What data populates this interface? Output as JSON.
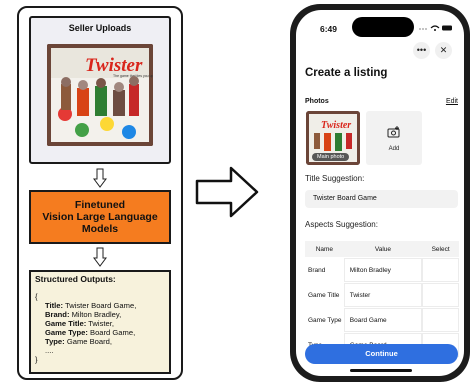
{
  "left": {
    "uploads_title": "Seller Uploads",
    "model_lines": [
      "Finetuned",
      "Vision Large Language",
      "Models"
    ],
    "outputs_title": "Structured Outputs:",
    "open_brace": "{",
    "close_brace": "}",
    "fields": [
      {
        "key": "Title:",
        "value": " Twister Board Game,"
      },
      {
        "key": "Brand:",
        "value": " Milton Bradley,"
      },
      {
        "key": "Game Title:",
        "value": " Twister,"
      },
      {
        "key": "Game Type:",
        "value": " Board Game,"
      },
      {
        "key": "Type:",
        "value": " Game Board,"
      }
    ],
    "ellipsis": "....",
    "box_text": "Twister"
  },
  "phone": {
    "time": "6:49",
    "title": "Create a listing",
    "photos_label": "Photos",
    "edit": "Edit",
    "main_photo": "Main photo",
    "add": "Add",
    "title_suggestion_label": "Title Suggestion:",
    "title_suggestion_value": "Twister Board Game",
    "aspects_label": "Aspects Suggestion:",
    "table_headers": [
      "Name",
      "Value",
      "Select"
    ],
    "table_rows": [
      {
        "name": "Brand",
        "value": "Milton Bradley"
      },
      {
        "name": "Game Title",
        "value": "Twister"
      },
      {
        "name": "Game Type",
        "value": "Board Game"
      },
      {
        "name": "Type",
        "value": "Game Board"
      }
    ],
    "continue": "Continue",
    "more_icon": "ellipsis-icon",
    "close_icon": "close-icon"
  },
  "colors": {
    "model_box": "#f57c1f",
    "outputs_box": "#f7f2dc",
    "continue_button": "#2f6fe0"
  }
}
